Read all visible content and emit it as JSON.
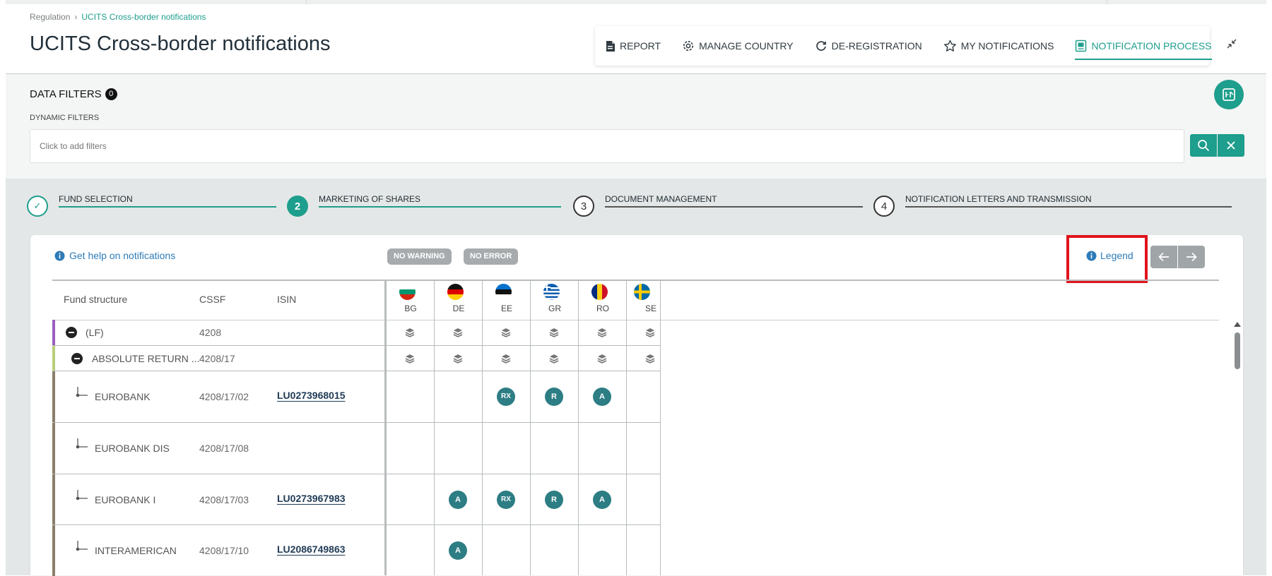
{
  "breadcrumb": {
    "root": "Regulation",
    "separator": "›",
    "current": "UCITS Cross-border notifications"
  },
  "page_title": "UCITS Cross-border notifications",
  "toolbar": {
    "report": "REPORT",
    "manage_country": "MANAGE COUNTRY",
    "deregistration": "DE-REGISTRATION",
    "my_notifications": "MY NOTIFICATIONS",
    "notification_process": "NOTIFICATION PROCESS"
  },
  "filters": {
    "title": "DATA FILTERS",
    "count": "0",
    "dynamic_label": "DYNAMIC FILTERS",
    "placeholder": "Click to add filters"
  },
  "steps": [
    {
      "number": "✓",
      "label": "FUND SELECTION",
      "state": "done"
    },
    {
      "number": "2",
      "label": "MARKETING OF SHARES",
      "state": "active"
    },
    {
      "number": "3",
      "label": "DOCUMENT MANAGEMENT",
      "state": "pending"
    },
    {
      "number": "4",
      "label": "NOTIFICATION LETTERS AND TRANSMISSION",
      "state": "pending"
    }
  ],
  "card": {
    "help_link": "Get help on notifications",
    "badge_warning": "NO WARNING",
    "badge_error": "NO ERROR",
    "legend": "Legend"
  },
  "table": {
    "headers": {
      "fund_structure": "Fund structure",
      "cssf": "CSSF",
      "isin": "ISIN"
    },
    "countries": [
      "BG",
      "DE",
      "EE",
      "GR",
      "RO",
      "SE"
    ],
    "rows": [
      {
        "name": "(LF)",
        "cssf": "4208",
        "isin": "",
        "type": "group",
        "statuses": [
          "stack",
          "stack",
          "stack",
          "stack",
          "stack",
          "stack"
        ]
      },
      {
        "name": "ABSOLUTE RETURN ...",
        "cssf": "4208/17",
        "isin": "",
        "type": "subgroup",
        "statuses": [
          "stack",
          "stack",
          "stack",
          "stack",
          "stack",
          "stack"
        ]
      },
      {
        "name": "EUROBANK",
        "cssf": "4208/17/02",
        "isin": "LU0273968015",
        "type": "leaf",
        "statuses": [
          "",
          "",
          "RX",
          "R",
          "A",
          ""
        ]
      },
      {
        "name": "EUROBANK DIS",
        "cssf": "4208/17/08",
        "isin": "",
        "type": "leaf",
        "statuses": [
          "",
          "",
          "",
          "",
          "",
          ""
        ]
      },
      {
        "name": "EUROBANK I",
        "cssf": "4208/17/03",
        "isin": "LU0273967983",
        "type": "leaf",
        "statuses": [
          "",
          "A",
          "RX",
          "R",
          "A",
          ""
        ]
      },
      {
        "name": "INTERAMERICAN",
        "cssf": "4208/17/10",
        "isin": "LU2086749863",
        "type": "leaf",
        "statuses": [
          "",
          "A",
          "",
          "",
          "",
          ""
        ]
      }
    ]
  },
  "colors": {
    "accent": "#1e9e8c",
    "status_badge": "#2d7d84",
    "link": "#2e7bb8",
    "highlight": "#e0141e",
    "lf_bar": "#9b5fc0",
    "subfund_bar": "#b9cf7a",
    "share_bar": "#8a7f6a"
  }
}
